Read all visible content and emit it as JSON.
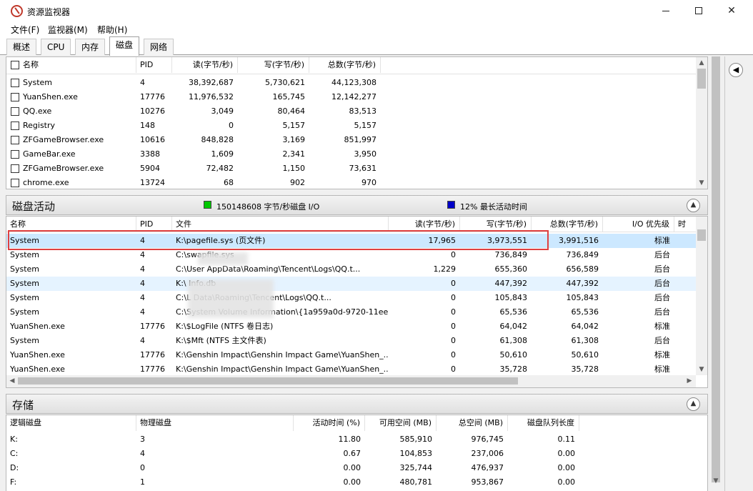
{
  "window": {
    "title": "资源监视器"
  },
  "menu": [
    "文件(F)",
    "监视器(M)",
    "帮助(H)"
  ],
  "tabs": [
    "概述",
    "CPU",
    "内存",
    "磁盘",
    "网络"
  ],
  "active_tab": "磁盘",
  "processes": {
    "columns": [
      "名称",
      "PID",
      "读(字节/秒)",
      "写(字节/秒)",
      "总数(字节/秒)"
    ],
    "rows": [
      [
        "System",
        "4",
        "38,392,687",
        "5,730,621",
        "44,123,308"
      ],
      [
        "YuanShen.exe",
        "17776",
        "11,976,532",
        "165,745",
        "12,142,277"
      ],
      [
        "QQ.exe",
        "10276",
        "3,049",
        "80,464",
        "83,513"
      ],
      [
        "Registry",
        "148",
        "0",
        "5,157",
        "5,157"
      ],
      [
        "ZFGameBrowser.exe",
        "10616",
        "848,828",
        "3,169",
        "851,997"
      ],
      [
        "GameBar.exe",
        "3388",
        "1,609",
        "2,341",
        "3,950"
      ],
      [
        "ZFGameBrowser.exe",
        "5904",
        "72,482",
        "1,150",
        "73,631"
      ],
      [
        "chrome.exe",
        "13724",
        "68",
        "902",
        "970"
      ]
    ]
  },
  "disk_activity": {
    "title": "磁盘活动",
    "io_label": "150148608 字节/秒磁盘 I/O",
    "active_label": "12% 最长活动时间",
    "io_color": "#00c800",
    "active_color": "#0000c8",
    "columns": [
      "名称",
      "PID",
      "文件",
      "读(字节/秒)",
      "写(字节/秒)",
      "总数(字节/秒)",
      "I/O 优先级",
      "时"
    ],
    "rows": [
      [
        "System",
        "4",
        "K:\\pagefile.sys (页文件)",
        "17,965",
        "3,973,551",
        "3,991,516",
        "标准"
      ],
      [
        "System",
        "4",
        "C:\\swapfile.sys",
        "0",
        "736,849",
        "736,849",
        "后台"
      ],
      [
        "System",
        "4",
        "C:\\User          AppData\\Roaming\\Tencent\\Logs\\QQ.t...",
        "1,229",
        "655,360",
        "656,589",
        "后台"
      ],
      [
        "System",
        "4",
        "K:\\                                   Info.db",
        "0",
        "447,392",
        "447,392",
        "后台"
      ],
      [
        "System",
        "4",
        "C:\\L                                Data\\Roaming\\Tencent\\Logs\\QQ.t...",
        "0",
        "105,843",
        "105,843",
        "后台"
      ],
      [
        "System",
        "4",
        "C:\\System Volume Information\\{1a959a0d-9720-11ee...",
        "0",
        "65,536",
        "65,536",
        "后台"
      ],
      [
        "YuanShen.exe",
        "17776",
        "K:\\$LogFile (NTFS 卷日志)",
        "0",
        "64,042",
        "64,042",
        "标准"
      ],
      [
        "System",
        "4",
        "K:\\$Mft (NTFS 主文件表)",
        "0",
        "61,308",
        "61,308",
        "后台"
      ],
      [
        "YuanShen.exe",
        "17776",
        "K:\\Genshin Impact\\Genshin Impact Game\\YuanShen_...",
        "0",
        "50,610",
        "50,610",
        "标准"
      ],
      [
        "YuanShen.exe",
        "17776",
        "K:\\Genshin Impact\\Genshin Impact Game\\YuanShen_...",
        "0",
        "35,728",
        "35,728",
        "标准"
      ]
    ]
  },
  "storage": {
    "title": "存储",
    "columns": [
      "逻辑磁盘",
      "物理磁盘",
      "活动时间 (%)",
      "可用空间 (MB)",
      "总空间 (MB)",
      "磁盘队列长度"
    ],
    "rows": [
      [
        "K:",
        "3",
        "11.80",
        "585,910",
        "976,745",
        "0.11"
      ],
      [
        "C:",
        "4",
        "0.67",
        "104,853",
        "237,006",
        "0.00"
      ],
      [
        "D:",
        "0",
        "0.00",
        "325,744",
        "476,937",
        "0.00"
      ],
      [
        "F:",
        "1",
        "0.00",
        "480,781",
        "953,867",
        "0.00"
      ]
    ]
  }
}
